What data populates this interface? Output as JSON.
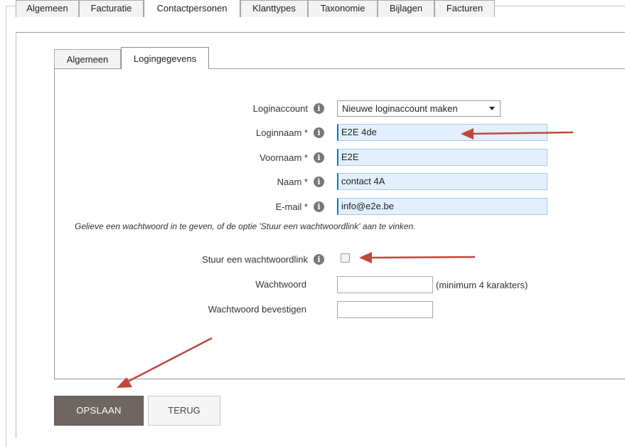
{
  "top_tabs": [
    "Algemeen",
    "Facturatie",
    "Contactpersonen",
    "Klanttypes",
    "Taxonomie",
    "Bijlagen",
    "Facturen"
  ],
  "active_top_tab": "Contactpersonen",
  "inner_tabs": [
    "Algemeen",
    "Logingegevens"
  ],
  "active_inner_tab": "Logingegevens",
  "form": {
    "loginaccount_label": "Loginaccount",
    "loginaccount_value": "Nieuwe loginaccount maken",
    "loginnaam_label": "Loginnaam *",
    "loginnaam_value": "E2E 4de",
    "voornaam_label": "Voornaam *",
    "voornaam_value": "E2E",
    "naam_label": "Naam *",
    "naam_value": "contact 4A",
    "email_label": "E-mail *",
    "email_value": "info@e2e.be",
    "note": "Gelieve een wachtwoord in te geven, of de optie 'Stuur een wachtwoordlink' aan te vinken.",
    "sendlink_label": "Stuur een wachtwoordlink",
    "sendlink_checked": false,
    "password_label": "Wachtwoord",
    "password_hint": "(minimum 4 karakters)",
    "password_confirm_label": "Wachtwoord bevestigen",
    "info_glyph": "i"
  },
  "buttons": {
    "save": "OPSLAAN",
    "back": "TERUG"
  },
  "colors": {
    "annotation_arrow": "#c0473a",
    "save_button": "#6f6561",
    "field_bg": "#e2f0fd"
  }
}
